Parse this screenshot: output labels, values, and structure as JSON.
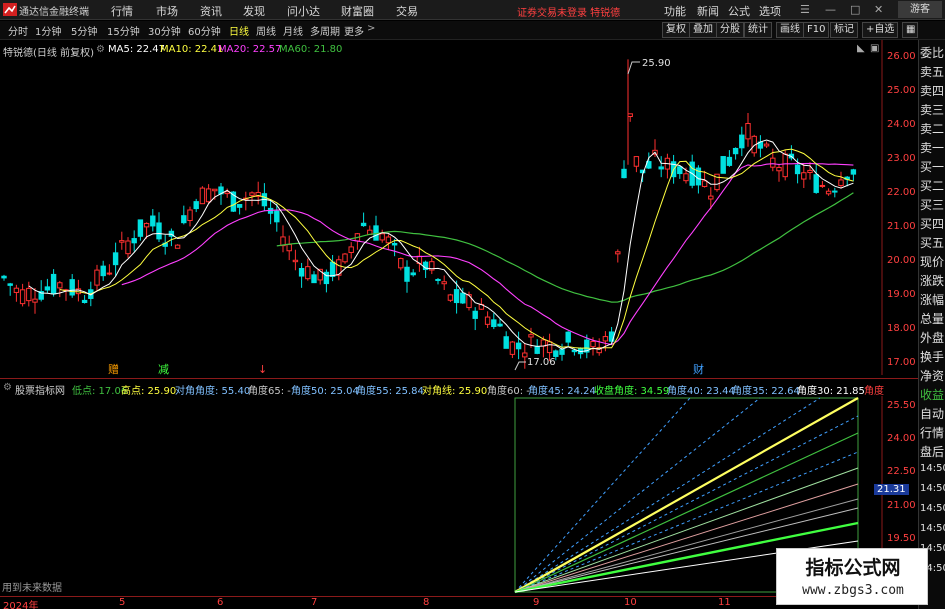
{
  "app": {
    "title": "通达信金融终端"
  },
  "menu": [
    "行情",
    "市场",
    "资讯",
    "发现",
    "问小达",
    "财富圈",
    "交易"
  ],
  "notice": "证券交易未登录 特锐德",
  "top_buttons": [
    "功能",
    "新闻",
    "公式",
    "选项"
  ],
  "guest": "游客",
  "periods": [
    "分时",
    "1分钟",
    "5分钟",
    "15分钟",
    "30分钟",
    "60分钟",
    "日线",
    "周线",
    "月线",
    "多周期",
    "更多"
  ],
  "right_tools": [
    "复权",
    "叠加",
    "分股",
    "统计",
    "画线",
    "F10",
    "标记",
    "+自选"
  ],
  "stock": {
    "name": "特锐德(日线 前复权)",
    "ma5": "MA5: 22.47",
    "ma10": "MA10: 22.41",
    "ma20": "MA20: 22.57",
    "ma60": "MA60: 21.80",
    "high_label": "25.90",
    "low_label": "17.06"
  },
  "side_panel": [
    "委比",
    "卖五",
    "卖四",
    "卖三",
    "卖二",
    "卖一",
    "买一",
    "买二",
    "买三",
    "买四",
    "买五",
    "现价",
    "涨跌",
    "涨幅",
    "总量",
    "外盘",
    "换手",
    "净资",
    "收益"
  ],
  "side_panel_low": [
    "自动",
    "行情",
    "盘后",
    "14:50",
    "14:50",
    "14:50",
    "14:50",
    "14:50",
    "14:50"
  ],
  "price_axis": [
    "26.00",
    "25.00",
    "24.00",
    "23.00",
    "22.00",
    "21.00",
    "20.00",
    "19.00",
    "18.00",
    "17.00"
  ],
  "low_axis": [
    "25.50",
    "24.00",
    "22.50",
    "21.00",
    "19.50"
  ],
  "low_axis_highlight": "21.31",
  "indicator": {
    "name": "股票指标网",
    "items": [
      {
        "label": "低点: 17.06",
        "color": "#40c040"
      },
      {
        "label": "高点: 25.90",
        "color": "#ffff40"
      },
      {
        "label": "对角角度: 55.40",
        "color": "#80c0ff"
      },
      {
        "label": "角度65: -",
        "color": "#c8c8c8"
      },
      {
        "label": "角度50: 25.04",
        "color": "#80c0ff"
      },
      {
        "label": "角度55: 25.84",
        "color": "#80c0ff"
      },
      {
        "label": "对角线: 25.90",
        "color": "#ffff40"
      },
      {
        "label": "角度60: -",
        "color": "#c8c8c8"
      },
      {
        "label": "角度45: 24.24",
        "color": "#80c0ff"
      },
      {
        "label": "收盘角度: 34.59",
        "color": "#40ff40"
      },
      {
        "label": "角度40: 23.44",
        "color": "#80c0ff"
      },
      {
        "label": "角度35: 22.64",
        "color": "#80c0ff"
      },
      {
        "label": "角度30: 21.85",
        "color": "#ffffff"
      },
      {
        "label": "角度",
        "color": "#ff4040"
      }
    ],
    "footnote": "用到未来数据"
  },
  "markers": [
    {
      "text": "赠",
      "color": "#ffa000"
    },
    {
      "text": "减",
      "color": "#40ff40"
    },
    {
      "text": "↓",
      "color": "#ff4040"
    },
    {
      "text": "财",
      "color": "#40a0ff"
    }
  ],
  "dates": [
    "2024年",
    "5",
    "6",
    "7",
    "8",
    "9",
    "10",
    "11"
  ],
  "watermark": {
    "title": "指标公式网",
    "url": "www.zbgs3.com"
  },
  "colors": {
    "up": "#ff3030",
    "down": "#00e0e0",
    "ma5": "#ffffff",
    "ma10": "#ffff40",
    "ma20": "#ff40ff",
    "ma60": "#40c040"
  }
}
